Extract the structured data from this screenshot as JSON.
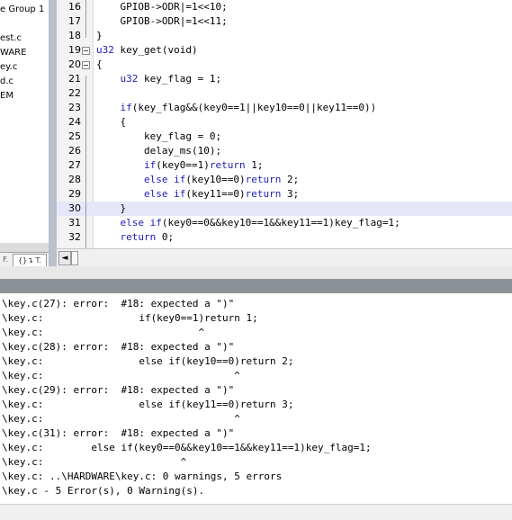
{
  "sidebar": {
    "items": [
      "e Group 1",
      "est.c",
      "WARE",
      "ey.c",
      "d.c",
      "EM"
    ],
    "tabs": [
      "F.",
      "{}↴ T."
    ]
  },
  "editor": {
    "lines": [
      {
        "n": "16",
        "code": "    GPIOB->ODR|=1<<10;"
      },
      {
        "n": "17",
        "code": "    GPIOB->ODR|=1<<11;"
      },
      {
        "n": "18",
        "code": "}"
      },
      {
        "n": "19",
        "code": "u32 key_get(void)"
      },
      {
        "n": "20",
        "code": "{"
      },
      {
        "n": "21",
        "code": "    u32 key_flag = 1;"
      },
      {
        "n": "22",
        "code": ""
      },
      {
        "n": "23",
        "code": "    if(key_flag&&(key0==1||key10==0||key11==0))"
      },
      {
        "n": "24",
        "code": "    {"
      },
      {
        "n": "25",
        "code": "        key_flag = 0;"
      },
      {
        "n": "26",
        "code": "        delay_ms(10);"
      },
      {
        "n": "27",
        "code": "        if(key0==1)return 1;"
      },
      {
        "n": "28",
        "code": "        else if(key10==0)return 2;"
      },
      {
        "n": "29",
        "code": "        else if(key11==0)return 3;"
      },
      {
        "n": "30",
        "code": "    }"
      },
      {
        "n": "31",
        "code": "    else if(key0==0&&key10==1&&key11==1)key_flag=1;"
      },
      {
        "n": "32",
        "code": "    return 0;"
      }
    ]
  },
  "scroll": {
    "left_arrow": "◄"
  },
  "build_output": {
    "lines": [
      "\\key.c(27): error:  #18: expected a \")\"",
      "\\key.c:                if(key0==1)return 1;",
      "\\key.c:                          ^",
      "\\key.c(28): error:  #18: expected a \")\"",
      "\\key.c:                else if(key10==0)return 2;",
      "\\key.c:                                ^",
      "\\key.c(29): error:  #18: expected a \")\"",
      "\\key.c:                else if(key11==0)return 3;",
      "\\key.c:                                ^",
      "\\key.c(31): error:  #18: expected a \")\"",
      "\\key.c:        else if(key0==0&&key10==1&&key11==1)key_flag=1;",
      "\\key.c:                       ^",
      "\\key.c: ..\\HARDWARE\\key.c: 0 warnings, 5 errors",
      "\\key.c - 5 Error(s), 0 Warning(s)."
    ]
  }
}
